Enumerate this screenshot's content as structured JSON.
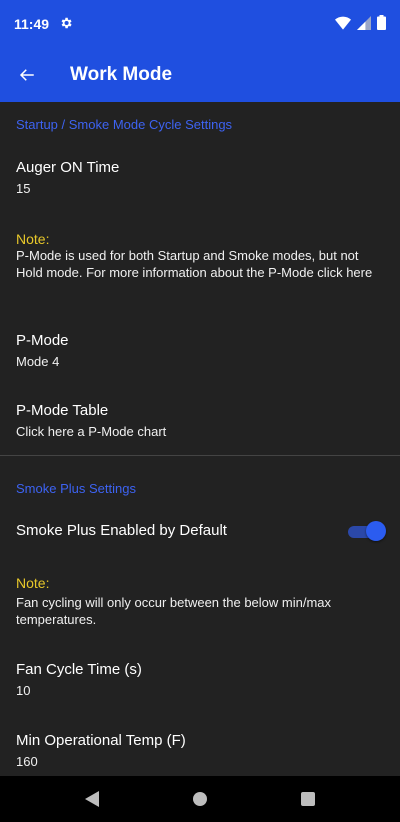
{
  "status": {
    "time": "11:49"
  },
  "app": {
    "title": "Work Mode"
  },
  "sections": {
    "startup": {
      "title": "Startup / Smoke Mode Cycle Settings",
      "auger": {
        "title": "Auger ON Time",
        "value": "15"
      },
      "note": {
        "title": "Note:",
        "text": "P-Mode is used for both Startup and Smoke modes, but not Hold mode. For more information about the P-Mode click here"
      },
      "pmode": {
        "title": "P-Mode",
        "value": "Mode 4"
      },
      "pmode_table": {
        "title": "P-Mode Table",
        "value": "Click here a P-Mode chart"
      }
    },
    "smoke_plus": {
      "title": "Smoke Plus Settings",
      "enabled": {
        "title": "Smoke Plus Enabled by Default",
        "checked": true
      },
      "note": {
        "title": "Note:",
        "text": "Fan cycling will only occur between the below min/max temperatures."
      },
      "fan_cycle": {
        "title": "Fan Cycle Time (s)",
        "value": "10"
      },
      "min_temp": {
        "title": "Min Operational Temp (F)",
        "value": "160"
      }
    }
  },
  "colors": {
    "appbar": "#1f4fe0",
    "accent": "#3d63f2",
    "note": "#e8c82a",
    "background": "#222222"
  }
}
